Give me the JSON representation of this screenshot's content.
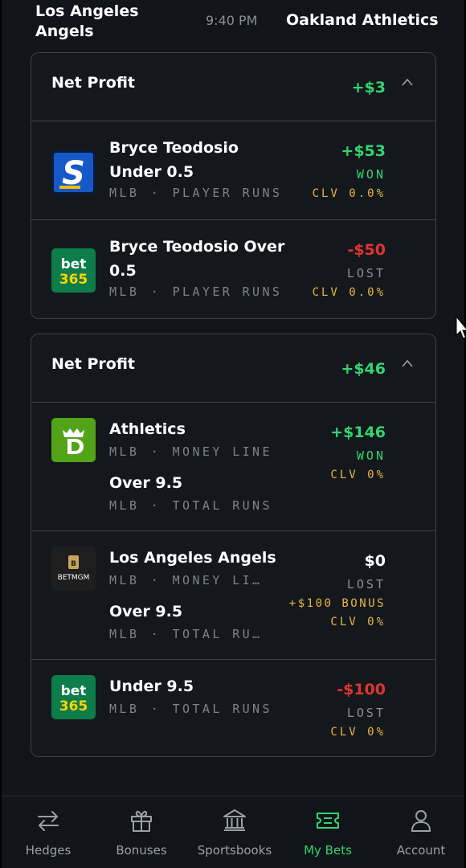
{
  "header": {
    "home_team": "Los Angeles Angels",
    "time": "9:40 PM",
    "away_team": "Oakland Athletics"
  },
  "cards": [
    {
      "net_profit_label": "Net Profit",
      "net_profit_value": "+$3",
      "rows": [
        {
          "book": "sportsbook-s-logo",
          "legs": [
            {
              "title": "Bryce Teodosio Under 0.5",
              "league": "MLB",
              "market": "PLAYER RUNS"
            }
          ],
          "amount": "+$53",
          "status": "WON",
          "clv": "CLV 0.0%"
        },
        {
          "book": "bet365-logo",
          "legs": [
            {
              "title": "Bryce Teodosio Over 0.5",
              "league": "MLB",
              "market": "PLAYER RUNS"
            }
          ],
          "amount": "-$50",
          "status": "LOST",
          "clv": "CLV 0.0%"
        }
      ]
    },
    {
      "net_profit_label": "Net Profit",
      "net_profit_value": "+$46",
      "rows": [
        {
          "book": "draftkings-logo",
          "legs": [
            {
              "title": "Athletics",
              "league": "MLB",
              "market": "MONEY LINE"
            },
            {
              "title": "Over 9.5",
              "league": "MLB",
              "market": "TOTAL RUNS"
            }
          ],
          "amount": "+$146",
          "status": "WON",
          "clv": "CLV 0%"
        },
        {
          "book": "betmgm-logo",
          "legs": [
            {
              "title": "Los Angeles Angels",
              "league": "MLB",
              "market": "MONEY LI…"
            },
            {
              "title": "Over 9.5",
              "league": "MLB",
              "market": "TOTAL RU…"
            }
          ],
          "amount": "$0",
          "status": "LOST",
          "bonus": "+$100 BONUS",
          "clv": "CLV 0%"
        },
        {
          "book": "bet365-logo",
          "legs": [
            {
              "title": "Under 9.5",
              "league": "MLB",
              "market": "TOTAL RUNS"
            }
          ],
          "amount": "-$100",
          "status": "LOST",
          "clv": "CLV 0%"
        }
      ]
    }
  ],
  "logos": {
    "bet365_line1": "bet",
    "bet365_line2": "365",
    "betmgm": "BETMGM",
    "s_letter": "S"
  },
  "separator": "·",
  "nav": [
    {
      "label": "Hedges",
      "icon": "arrows-swap-icon"
    },
    {
      "label": "Bonuses",
      "icon": "gift-icon"
    },
    {
      "label": "Sportsbooks",
      "icon": "bank-icon"
    },
    {
      "label": "My Bets",
      "icon": "ticket-icon",
      "active": true
    },
    {
      "label": "Account",
      "icon": "user-icon"
    }
  ],
  "colors": {
    "positive": "#35d46f",
    "negative": "#e0342f",
    "clv": "#e7b73f",
    "background": "#111418",
    "border": "#3c4048"
  }
}
